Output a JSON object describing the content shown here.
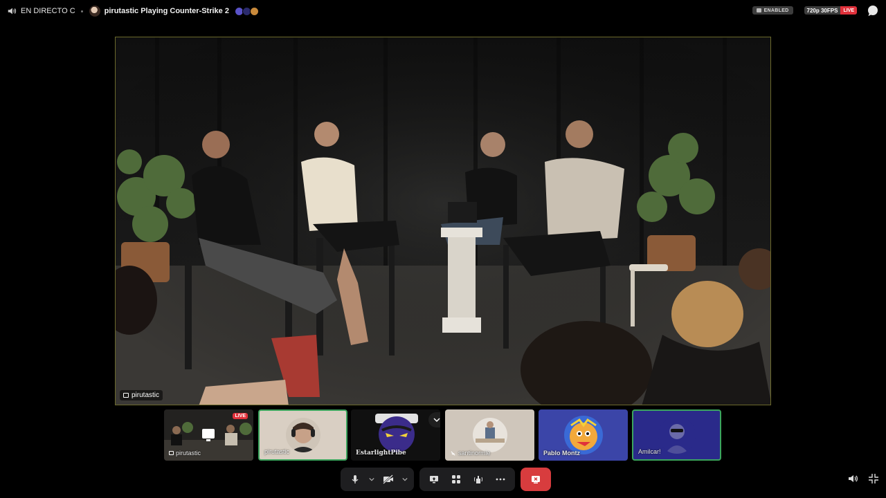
{
  "top_bar": {
    "live_label": "EN DIRECTO C",
    "stream_title": "pirutastic Playing Counter-Strike 2",
    "enabled_label": "ENABLED",
    "quality_label": "720p 30FPS",
    "live_badge": "LIVE"
  },
  "stage": {
    "streamer_tag": "pirutastic"
  },
  "tiles": [
    {
      "name": "pirutastic",
      "live": "LIVE"
    },
    {
      "name": "pirutastic"
    },
    {
      "name": "EstarlightPibe"
    },
    {
      "name": "santinormie"
    },
    {
      "name": "Pablo Montz"
    },
    {
      "name": "Amilcar!"
    }
  ],
  "icons": {
    "top_left": "speaker-icon",
    "enabled": "screen-share-icon",
    "chat": "chat-bubble-icon",
    "mic": "microphone-icon",
    "camera": "camera-off-icon",
    "share": "screen-share-icon",
    "activities": "activities-icon",
    "soundboard": "soundboard-icon",
    "more": "more-icon",
    "end": "end-call-icon",
    "volume": "volume-icon",
    "fullscreen": "exit-fullscreen-icon"
  },
  "colors": {
    "live_red": "#e0313b",
    "active_green": "#3ba55d",
    "end_call": "#d83c3e",
    "stage_border": "#6c6a2c"
  }
}
